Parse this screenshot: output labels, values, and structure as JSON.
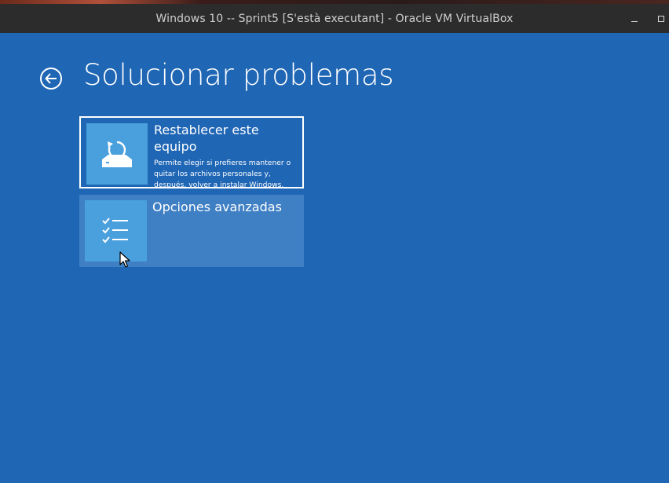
{
  "window": {
    "title": "Windows 10 -- Sprint5 [S'està executant] - Oracle VM VirtualBox",
    "controls": [
      "minimize-icon",
      "maximize-icon"
    ]
  },
  "page": {
    "title": "Solucionar problemas",
    "back_icon": "back-arrow-circle-icon"
  },
  "options": [
    {
      "title": "Restablecer este equipo",
      "description": "Permite elegir si prefieres mantener o quitar los archivos personales y, después, volver a instalar Windows.",
      "icon": "reset-pc-icon",
      "selected": true
    },
    {
      "title": "Opciones avanzadas",
      "description": "",
      "icon": "checklist-icon",
      "selected": false
    }
  ],
  "colors": {
    "background": "#1f66b5",
    "tile_icon_bg": "#4aa0dd",
    "tile_hover_bg": "#3f7fc4",
    "titlebar_bg": "#2c2c2c"
  }
}
